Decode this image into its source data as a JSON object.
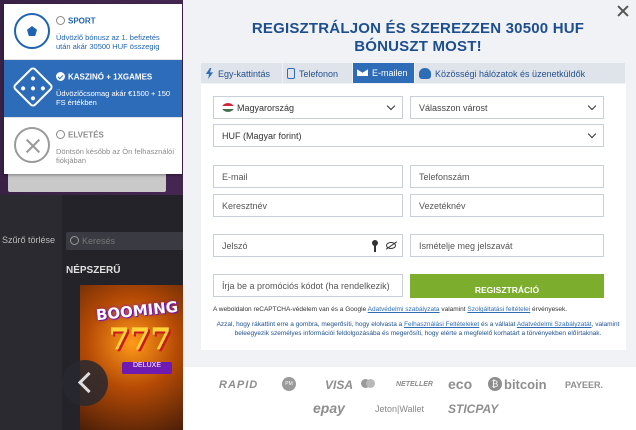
{
  "background": {
    "filter_clear": "Szűrő törlése",
    "search_placeholder": "Keresés",
    "popular_label": "NÉPSZERŰ",
    "game_title": "BOOMING",
    "game_number": "777",
    "game_subtitle": "DELUXE"
  },
  "bonus_options": [
    {
      "title": "SPORT",
      "description": "Üdvözlő bónusz az 1. befizetés után akár 30500 HUF összegig",
      "state": "available",
      "icon": "soccer-ball-icon"
    },
    {
      "title": "KASZINÓ + 1XGAMES",
      "description": "Üdvözlőcsomag akár €1500 + 150 FS értékben",
      "state": "selected",
      "icon": "dice-icon"
    },
    {
      "title": "ELVETÉS",
      "description": "Döntsön később az Ön felhasználói fiókjában",
      "state": "disabled",
      "icon": "cancel-circle-icon"
    }
  ],
  "modal": {
    "title": "REGISZTRÁLJON ÉS SZEREZZEN 30500 HUF BÓNUSZT MOST!",
    "tabs": [
      {
        "label": "Egy-kattintás",
        "icon": "lightning-icon",
        "active": false
      },
      {
        "label": "Telefonon",
        "icon": "phone-icon",
        "active": false
      },
      {
        "label": "E-mailen",
        "icon": "envelope-icon",
        "active": true
      },
      {
        "label": "Közösségi hálózatok és üzenetküldők",
        "icon": "people-icon",
        "active": false
      }
    ],
    "form": {
      "country": "Magyarország",
      "city_placeholder": "Válasszon várost",
      "currency": "HUF (Magyar forint)",
      "email_placeholder": "E-mail",
      "phone_placeholder": "Telefonszám",
      "first_name_placeholder": "Keresztnév",
      "last_name_placeholder": "Vezetéknév",
      "password_placeholder": "Jelszó",
      "password_repeat_placeholder": "Ismételje meg jelszavát",
      "promo_placeholder": "Írja be a promóciós kódot (ha rendelkezik)",
      "register_button": "REGISZTRÁCIÓ"
    },
    "captcha": {
      "prefix": "A weboldalon reCAPTCHA-védelem van és a Google ",
      "privacy_link": "Adatvédelmi szabályzata",
      "middle": " valamint ",
      "terms_link": "Szolgáltatási feltételei",
      "suffix": " érvényesek."
    },
    "consent": {
      "part1": "Azzal, hogy rákattint erre a gombra, megerősíti, hogy elolvasta a ",
      "link1": "Felhasználási Feltételeket",
      "part2": " és a vállalat ",
      "link2": "Adatvédelmi Szabályzatát",
      "part3": ", valamint beleegyezik személyes információi feldolgozásába és megerősíti, hogy elérte a megfelelő korhatárt a törvényekben előírtaknak."
    },
    "payment_methods": [
      "RAPID",
      "PM",
      "VISA",
      "NETELLER",
      "eco",
      "bitcoin",
      "PAYEER.",
      "epay",
      "Jeton|Wallet",
      "STICPAY"
    ]
  }
}
